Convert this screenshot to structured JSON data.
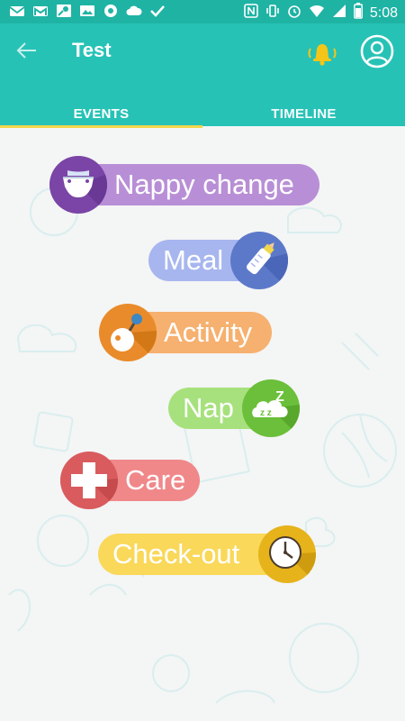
{
  "status_bar": {
    "left_icons": [
      "mail-icon",
      "gmail-icon",
      "maps-icon",
      "photo-icon",
      "circle-icon",
      "cloud-icon",
      "check-icon"
    ],
    "right_icons": [
      "nfc-icon",
      "vibrate-icon",
      "alarm-icon",
      "wifi-icon",
      "signal-icon",
      "battery-icon"
    ],
    "time": "5:08"
  },
  "app_bar": {
    "title": "Test",
    "back_icon": "arrow-left-icon",
    "bell_icon": "bell-icon",
    "profile_icon": "user-circle-icon"
  },
  "tabs": [
    {
      "label": "EVENTS",
      "active": true
    },
    {
      "label": "TIMELINE",
      "active": false
    }
  ],
  "events": [
    {
      "label": "Nappy change",
      "icon": "nappy-icon",
      "color": "#b88fd6"
    },
    {
      "label": "Meal",
      "icon": "bottle-icon",
      "color": "#a7b6ee"
    },
    {
      "label": "Activity",
      "icon": "toy-icon",
      "color": "#f6b06f"
    },
    {
      "label": "Nap",
      "icon": "sleep-cloud-icon",
      "color": "#a7e17d"
    },
    {
      "label": "Care",
      "icon": "cross-icon",
      "color": "#f0888a"
    },
    {
      "label": "Check-out",
      "icon": "clock-icon",
      "color": "#f9d85a"
    }
  ],
  "colors": {
    "status_bar": "#1fb3a4",
    "app_bar": "#27c2b6",
    "tab_indicator": "#f2d64b",
    "background": "#f4f5f5"
  }
}
